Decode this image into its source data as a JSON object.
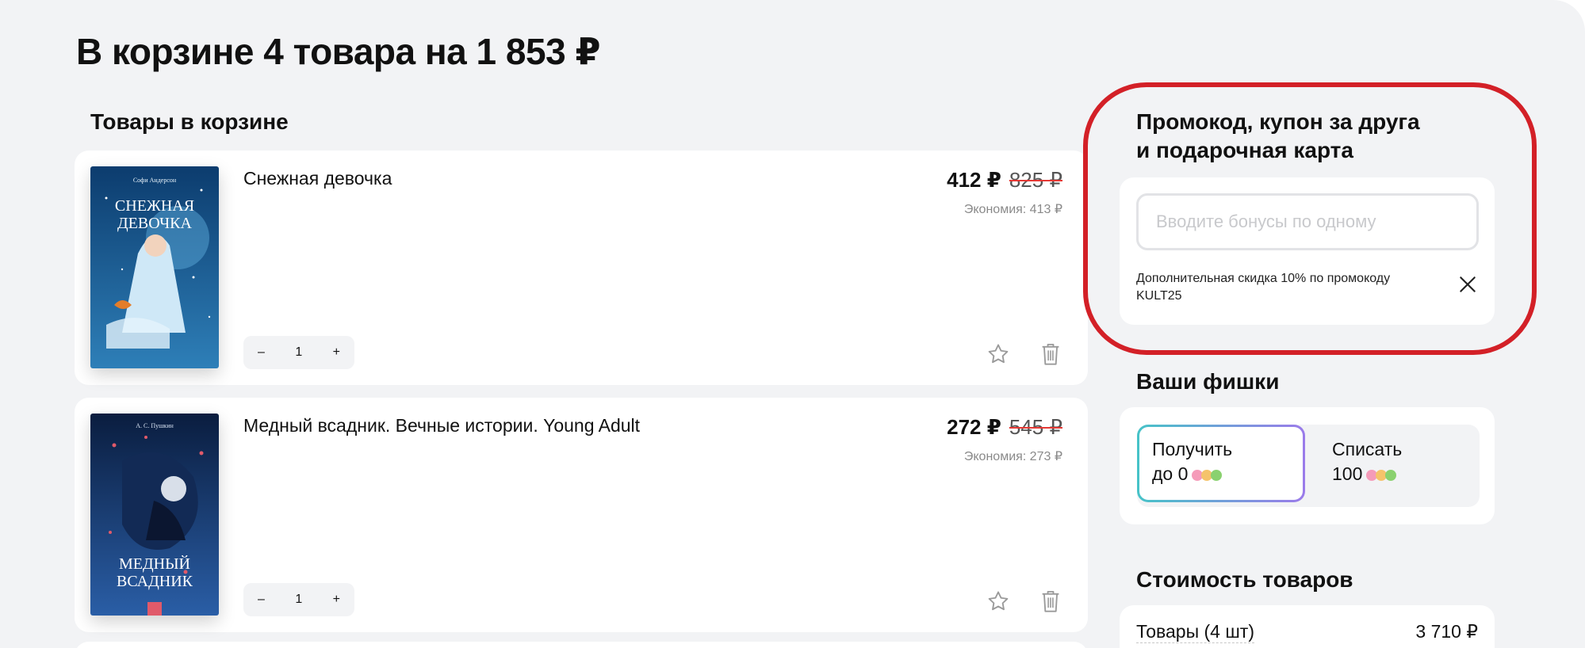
{
  "page": {
    "title": "В корзине 4 товара на 1 853 ₽",
    "cart_section_title": "Товары в корзине"
  },
  "items": [
    {
      "name": "Снежная девочка",
      "price": "412 ₽",
      "old_price": "825 ₽",
      "economy": "Экономия: 413 ₽",
      "qty": "1",
      "minus": "–",
      "plus": "+",
      "cover": {
        "top_text": "Софи Андерсон",
        "title_line1": "СНЕЖНАЯ",
        "title_line2": "ДЕВОЧКА",
        "colors": [
          "#0c3c6e",
          "#2e7fb8"
        ]
      }
    },
    {
      "name": "Медный всадник. Вечные истории. Young Adult",
      "price": "272 ₽",
      "old_price": "545 ₽",
      "economy": "Экономия: 273 ₽",
      "qty": "1",
      "minus": "–",
      "plus": "+",
      "cover": {
        "top_text": "А. С. Пушкин",
        "title_line1": "МЕДНЫЙ",
        "title_line2": "ВСАДНИК",
        "colors": [
          "#0a1d3f",
          "#2a5ea6"
        ]
      }
    }
  ],
  "promo": {
    "title_line1": "Промокод, купон за друга",
    "title_line2": "и подарочная карта",
    "input_placeholder": "Вводите бонусы по одному",
    "note": "Дополнительная скидка 10% по промокоду KULT25"
  },
  "chips": {
    "title": "Ваши фишки",
    "get_label": "Получить",
    "get_value": "до 0",
    "spend_label": "Списать",
    "spend_value": "100"
  },
  "totals": {
    "title": "Стоимость товаров",
    "items_label": "Товары (4 шт)",
    "items_value": "3 710 ₽"
  },
  "colors": {
    "background": "#f2f3f5",
    "card": "#ffffff",
    "highlight_red": "#d32027",
    "strike_red": "#e53935",
    "chip_gradient_start": "#46c3c8",
    "chip_gradient_end": "#9b7bea"
  },
  "icons": [
    "star-icon",
    "trash-icon",
    "close-icon",
    "coins-icon"
  ]
}
